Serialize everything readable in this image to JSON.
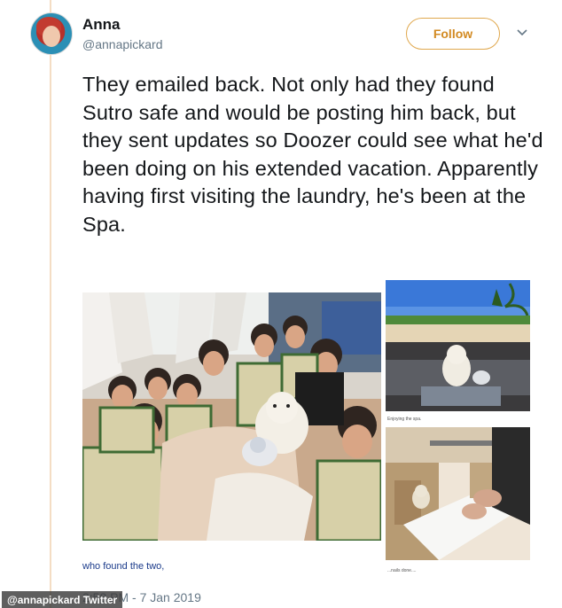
{
  "author": {
    "display_name": "Anna",
    "handle": "@annapickard"
  },
  "follow_label": "Follow",
  "tweet": {
    "text": "They emailed back. Not only had they found Sutro safe and would be posting him back, but they sent updates so Doozer could see what he'd been doing on his extended vacation. Apparently having first visiting the laundry, he's been at the Spa."
  },
  "media": {
    "main_caption": "who found the two,",
    "pool_caption": "Enjoying the spa.",
    "nail_caption": "...nails done...."
  },
  "timestamp": "7 Jan 2019",
  "timestamp_prefix": "2:58 PM -",
  "watermark": "@annapickard Twitter",
  "colors": {
    "follow_accent": "#d28a22",
    "follow_border": "#e0a84e",
    "handle_gray": "#657786",
    "caption_blue": "#1a3a8a"
  },
  "icons": [
    "chevron-down-icon",
    "avatar"
  ]
}
